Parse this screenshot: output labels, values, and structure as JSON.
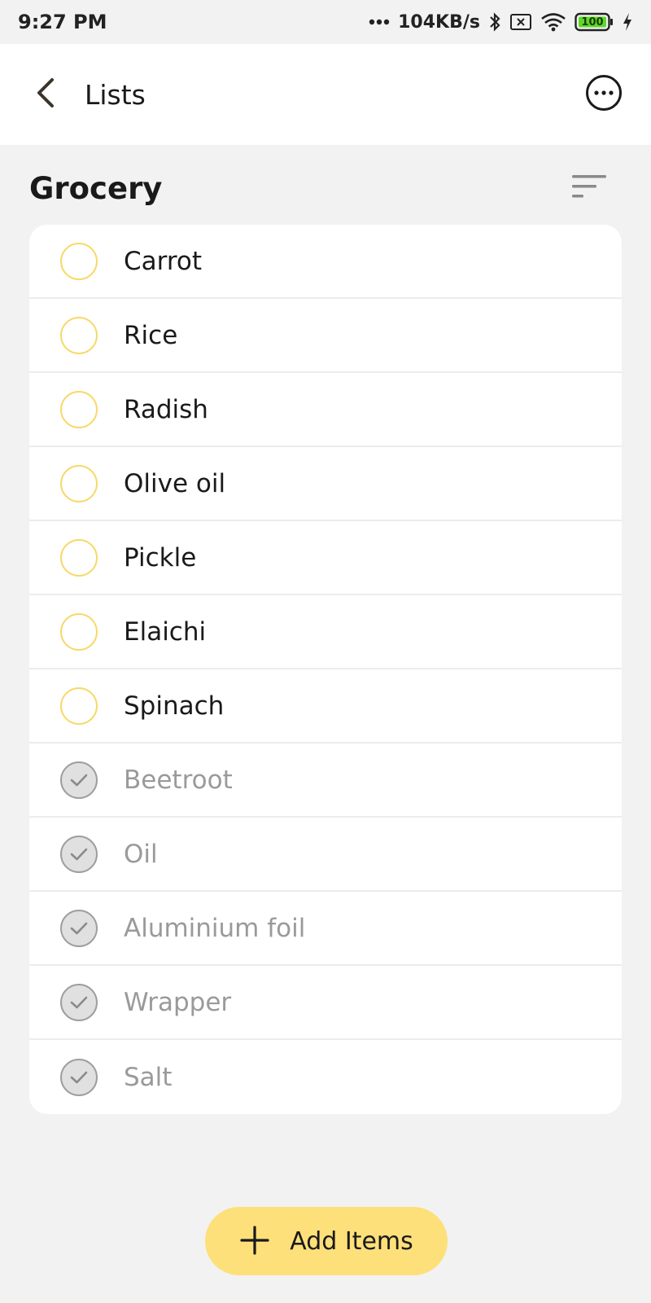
{
  "status_bar": {
    "time": "9:27 PM",
    "net_speed": "104KB/s",
    "battery": "100",
    "icons": [
      "signal-dots-icon",
      "bluetooth-icon",
      "sim-x-icon",
      "wifi-icon",
      "battery-icon",
      "charging-bolt-icon"
    ]
  },
  "app_bar": {
    "title": "Lists",
    "back_icon": "back-arrow-icon",
    "more_icon": "more-options-icon"
  },
  "list": {
    "title": "Grocery",
    "sort_icon": "sort-icon",
    "items": [
      {
        "label": "Carrot",
        "checked": false
      },
      {
        "label": "Rice",
        "checked": false
      },
      {
        "label": "Radish",
        "checked": false
      },
      {
        "label": "Olive oil",
        "checked": false
      },
      {
        "label": "Pickle",
        "checked": false
      },
      {
        "label": "Elaichi",
        "checked": false
      },
      {
        "label": "Spinach",
        "checked": false
      },
      {
        "label": "Beetroot",
        "checked": true
      },
      {
        "label": "Oil",
        "checked": true
      },
      {
        "label": "Aluminium foil",
        "checked": true
      },
      {
        "label": "Wrapper",
        "checked": true
      },
      {
        "label": "Salt",
        "checked": true
      }
    ]
  },
  "fab": {
    "label": "Add Items",
    "icon": "plus-icon"
  },
  "colors": {
    "accent": "#fde07a",
    "unchecked_ring": "#f7d96a",
    "checked_fill": "#e0e0e0",
    "done_text": "#9a9a9a"
  }
}
